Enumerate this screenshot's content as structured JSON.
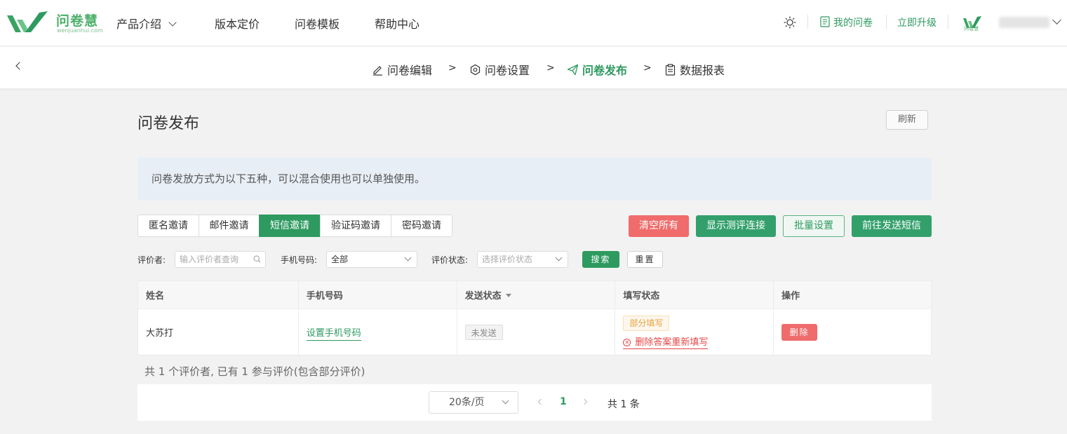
{
  "brand": {
    "name_cn": "问卷慧",
    "domain_text": "wenjuanhui.com",
    "color": "#4caf6a"
  },
  "top_nav": {
    "items": [
      {
        "label": "产品介绍",
        "has_dropdown": true
      },
      {
        "label": "版本定价"
      },
      {
        "label": "问卷模板"
      },
      {
        "label": "帮助中心"
      }
    ],
    "theme_icon": "sun-icon",
    "my_surveys": "我的问卷",
    "upgrade": "立即升级",
    "avatar_caption": "问卷慧",
    "username": ""
  },
  "steps": [
    {
      "label": "问卷编辑",
      "icon": "edit-icon",
      "active": false
    },
    {
      "label": "问卷设置",
      "icon": "settings-icon",
      "active": false
    },
    {
      "label": "问卷发布",
      "icon": "send-icon",
      "active": true
    },
    {
      "label": "数据报表",
      "icon": "clipboard-icon",
      "active": false
    }
  ],
  "step_separator": ">",
  "page": {
    "title": "问卷发布",
    "refresh": "刷新",
    "notice": "问卷发放方式为以下五种，可以混合使用也可以单独使用。"
  },
  "tabs": [
    {
      "label": "匿名邀请",
      "active": false
    },
    {
      "label": "邮件邀请",
      "active": false
    },
    {
      "label": "短信邀请",
      "active": true
    },
    {
      "label": "验证码邀请",
      "active": false
    },
    {
      "label": "密码邀请",
      "active": false
    }
  ],
  "actions": {
    "clear_all": "清空所有",
    "show_eval_link": "显示测评连接",
    "batch_settings": "批量设置",
    "go_send_sms": "前往发送短信"
  },
  "filters": {
    "evaluator_label": "评价者:",
    "evaluator_placeholder": "输入评价者查询",
    "phone_label": "手机号码:",
    "phone_value": "全部",
    "status_label": "评价状态:",
    "status_placeholder": "选择评价状态",
    "search": "搜索",
    "reset": "重置"
  },
  "table": {
    "columns": [
      "姓名",
      "手机号码",
      "发送状态",
      "填写状态",
      "操作"
    ],
    "rows": [
      {
        "name": "大苏打",
        "phone_action": "设置手机号码",
        "send_status": "未发送",
        "fill_status": "部分填写",
        "fill_action": "删除答案重新填写",
        "op": "删除"
      }
    ]
  },
  "summary": "共 1 个评价者, 已有 1 参与评价(包含部分评价)",
  "pagination": {
    "page_size": "20条/页",
    "current": "1",
    "total": "共 1 条"
  },
  "colors": {
    "primary": "#2e9a60",
    "danger": "#f06b6b",
    "warning": "#e6a23c"
  }
}
